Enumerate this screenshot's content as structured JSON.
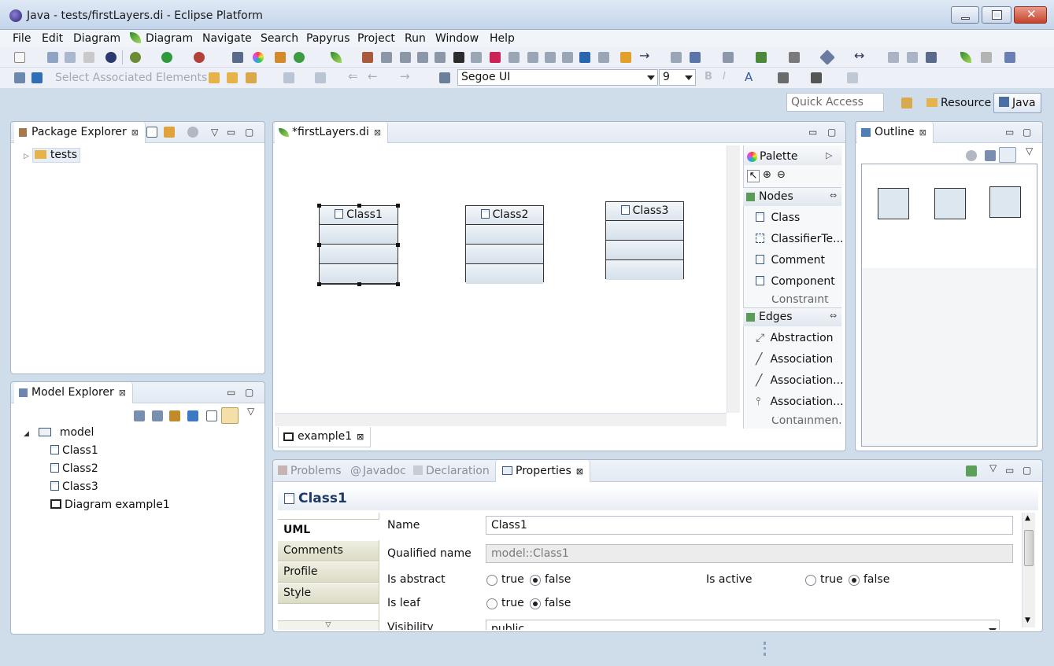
{
  "window": {
    "title": "Java - tests/firstLayers.di - Eclipse Platform"
  },
  "menu": [
    "File",
    "Edit",
    "Diagram",
    "Diagram",
    "Navigate",
    "Search",
    "Papyrus",
    "Project",
    "Run",
    "Window",
    "Help"
  ],
  "toolbar": {
    "select_associated": "Select Associated Elements",
    "font_name": "Segoe UI",
    "font_size": "9"
  },
  "perspective": {
    "quick_access_placeholder": "Quick Access",
    "resource": "Resource",
    "java": "Java"
  },
  "package_explorer": {
    "tab": "Package Explorer",
    "items": [
      "tests"
    ]
  },
  "model_explorer": {
    "tab": "Model Explorer",
    "root": "model",
    "children": [
      "Class1",
      "Class2",
      "Class3",
      "Diagram example1"
    ]
  },
  "editor": {
    "tab": "*firstLayers.di",
    "bottom_tab": "example1",
    "classes": [
      "Class1",
      "Class2",
      "Class3"
    ]
  },
  "palette": {
    "title": "Palette",
    "nodes_title": "Nodes",
    "nodes": [
      "Class",
      "ClassifierTe...",
      "Comment",
      "Component",
      "Constraint"
    ],
    "edges_title": "Edges",
    "edges": [
      "Abstraction",
      "Association",
      "Association...",
      "Association...",
      "Containmen..."
    ]
  },
  "outline": {
    "tab": "Outline"
  },
  "bottom_tabs": {
    "problems": "Problems",
    "javadoc": "Javadoc",
    "declaration": "Declaration",
    "properties": "Properties"
  },
  "properties": {
    "title": "Class1",
    "side_tabs": [
      "UML",
      "Comments",
      "Profile",
      "Style"
    ],
    "name_label": "Name",
    "name_value": "Class1",
    "qualified_label": "Qualified name",
    "qualified_value": "model::Class1",
    "abstract_label": "Is abstract",
    "active_label": "Is active",
    "leaf_label": "Is leaf",
    "visibility_label": "Visibility",
    "visibility_value": "public",
    "true_label": "true",
    "false_label": "false"
  }
}
